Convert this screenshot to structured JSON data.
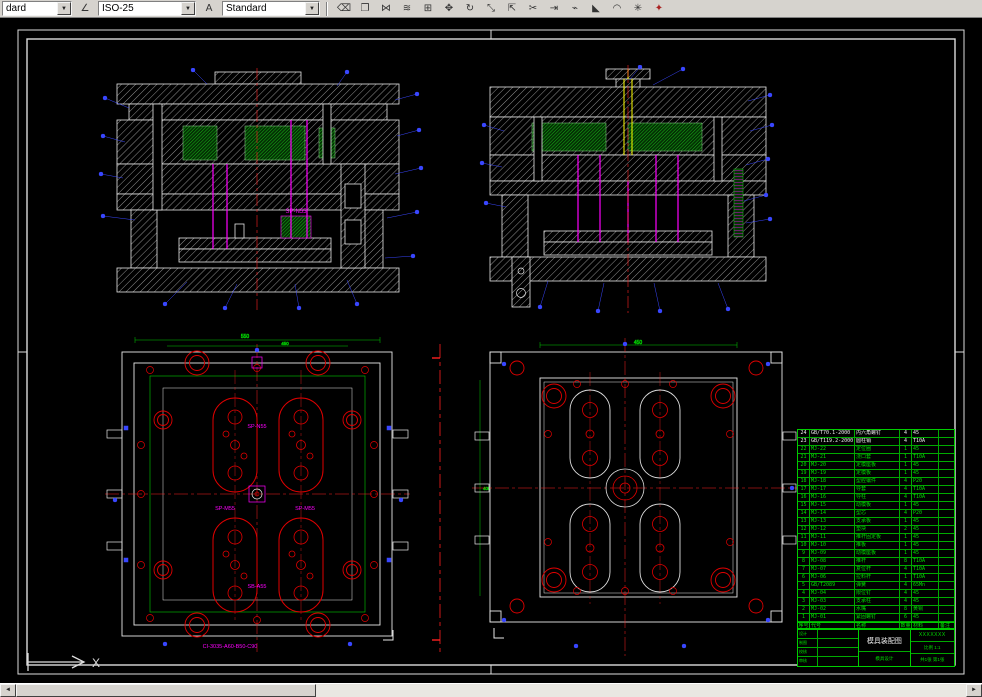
{
  "colors": {
    "canvas_bg": "#000000",
    "line": "#e0e0e0",
    "green": "#00cc00",
    "red": "#e00000",
    "magenta": "#ff00ff",
    "blue": "#3946ff",
    "yellow": "#ffff00",
    "toolbar_bg": "#d6d3ce"
  },
  "toolbar": {
    "layer_combo_value": "dard",
    "dimstyle_combo_value": "ISO-25",
    "textstyle_combo_value": "Standard",
    "combo_arrow": "▼",
    "dim_icon_glyph": "∠",
    "text_icon_glyph": "A",
    "icons": [
      {
        "name": "erase-icon",
        "glyph": "⌫"
      },
      {
        "name": "copy-icon",
        "glyph": "❐"
      },
      {
        "name": "mirror-icon",
        "glyph": "⋈"
      },
      {
        "name": "offset-icon",
        "glyph": "≋"
      },
      {
        "name": "array-icon",
        "glyph": "⊞"
      },
      {
        "name": "move-icon",
        "glyph": "✥"
      },
      {
        "name": "rotate-icon",
        "glyph": "↻"
      },
      {
        "name": "scale-icon",
        "glyph": "⤡"
      },
      {
        "name": "stretch-icon",
        "glyph": "⇱"
      },
      {
        "name": "trim-icon",
        "glyph": "✂"
      },
      {
        "name": "extend-icon",
        "glyph": "⇥"
      },
      {
        "name": "break-icon",
        "glyph": "⌁"
      },
      {
        "name": "chamfer-icon",
        "glyph": "◣"
      },
      {
        "name": "fillet-icon",
        "glyph": "◠"
      },
      {
        "name": "explode-icon",
        "glyph": "✳"
      },
      {
        "name": "properties-icon",
        "glyph": "✦",
        "accent": true
      }
    ]
  },
  "views": {
    "tl": {
      "part_label": "SP-N55"
    },
    "bl": {
      "dim_width": "550",
      "dim_inner": "450",
      "label_top": "SP-N55",
      "label_left": "SP-M55",
      "label_right": "SP-M55",
      "label_bottom": "SB-A55",
      "note": "CI-3035-A60-B50-C90"
    },
    "br": {
      "dim_width": "450",
      "dim_height": "400"
    }
  },
  "parts_table": {
    "headers": [
      "序号",
      "代号",
      "名称",
      "数量",
      "材料",
      "备注"
    ],
    "rows": [
      {
        "no": "24",
        "code": "GB/T70.1-2000",
        "name": "内六角螺钉",
        "qty": "4",
        "mat": "45",
        "note": "",
        "highlight": true
      },
      {
        "no": "23",
        "code": "GB/T119.2-2000",
        "name": "圆柱销",
        "qty": "4",
        "mat": "T10A",
        "note": "",
        "highlight": true
      },
      {
        "no": "22",
        "code": "MJ-22",
        "name": "定位圈",
        "qty": "1",
        "mat": "45",
        "note": ""
      },
      {
        "no": "21",
        "code": "MJ-21",
        "name": "浇口套",
        "qty": "1",
        "mat": "T10A",
        "note": ""
      },
      {
        "no": "20",
        "code": "MJ-20",
        "name": "定模座板",
        "qty": "1",
        "mat": "45",
        "note": ""
      },
      {
        "no": "19",
        "code": "MJ-19",
        "name": "定模板",
        "qty": "1",
        "mat": "45",
        "note": ""
      },
      {
        "no": "18",
        "code": "MJ-18",
        "name": "型腔镶件",
        "qty": "4",
        "mat": "P20",
        "note": ""
      },
      {
        "no": "17",
        "code": "MJ-17",
        "name": "导套",
        "qty": "4",
        "mat": "T10A",
        "note": ""
      },
      {
        "no": "16",
        "code": "MJ-16",
        "name": "导柱",
        "qty": "4",
        "mat": "T10A",
        "note": ""
      },
      {
        "no": "15",
        "code": "MJ-15",
        "name": "动模板",
        "qty": "1",
        "mat": "45",
        "note": ""
      },
      {
        "no": "14",
        "code": "MJ-14",
        "name": "型芯",
        "qty": "4",
        "mat": "P20",
        "note": ""
      },
      {
        "no": "13",
        "code": "MJ-13",
        "name": "支承板",
        "qty": "1",
        "mat": "45",
        "note": ""
      },
      {
        "no": "12",
        "code": "MJ-12",
        "name": "垫块",
        "qty": "2",
        "mat": "45",
        "note": ""
      },
      {
        "no": "11",
        "code": "MJ-11",
        "name": "推杆固定板",
        "qty": "1",
        "mat": "45",
        "note": ""
      },
      {
        "no": "10",
        "code": "MJ-10",
        "name": "推板",
        "qty": "1",
        "mat": "45",
        "note": ""
      },
      {
        "no": "9",
        "code": "MJ-09",
        "name": "动模座板",
        "qty": "1",
        "mat": "45",
        "note": ""
      },
      {
        "no": "8",
        "code": "MJ-08",
        "name": "推杆",
        "qty": "8",
        "mat": "T10A",
        "note": ""
      },
      {
        "no": "7",
        "code": "MJ-07",
        "name": "复位杆",
        "qty": "4",
        "mat": "T10A",
        "note": ""
      },
      {
        "no": "6",
        "code": "MJ-06",
        "name": "拉料杆",
        "qty": "1",
        "mat": "T10A",
        "note": ""
      },
      {
        "no": "5",
        "code": "GB/T2089",
        "name": "弹簧",
        "qty": "4",
        "mat": "65Mn",
        "note": ""
      },
      {
        "no": "4",
        "code": "MJ-04",
        "name": "限位钉",
        "qty": "4",
        "mat": "45",
        "note": ""
      },
      {
        "no": "3",
        "code": "MJ-03",
        "name": "支承柱",
        "qty": "4",
        "mat": "45",
        "note": ""
      },
      {
        "no": "2",
        "code": "MJ-02",
        "name": "水嘴",
        "qty": "8",
        "mat": "黄铜",
        "note": ""
      },
      {
        "no": "1",
        "code": "MJ-01",
        "name": "紧固螺钉",
        "qty": "6",
        "mat": "45",
        "note": ""
      }
    ]
  },
  "title_block": {
    "rows_left": [
      {
        "label": "设计",
        "value": ""
      },
      {
        "label": "制图",
        "value": ""
      },
      {
        "label": "校核",
        "value": ""
      },
      {
        "label": "审核",
        "value": ""
      }
    ],
    "title": "模具装配图",
    "org": "模具设计",
    "drawing_no": "XXXXXXX",
    "scale_label": "比例",
    "scale": "1:1",
    "sheet": "共1张 第1张"
  },
  "ucs": {
    "axis_label": "X"
  },
  "scrollbar": {
    "left_arrow": "◄",
    "right_arrow": "►"
  }
}
